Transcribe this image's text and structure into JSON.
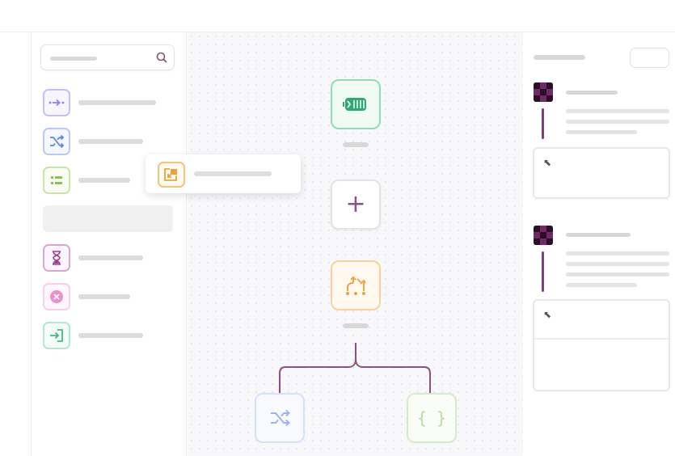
{
  "colors": {
    "purple": "#9b8cf0",
    "blue": "#8aa6f5",
    "green": "#9ad16a",
    "plum": "#b36aa8",
    "pink": "#f0a6d8",
    "teal": "#6fd1a9",
    "orange": "#f5c27a",
    "connector": "#8b4f86"
  },
  "sidebar": {
    "search_icon": "search-icon",
    "items": [
      {
        "icon": "merge-arrows-icon",
        "color": "#9b8cf0"
      },
      {
        "icon": "shuffle-icon",
        "color": "#8aa6f5"
      },
      {
        "icon": "grid-list-icon",
        "color": "#9ad16a"
      },
      {
        "icon": "hourglass-icon",
        "color": "#b36aa8"
      },
      {
        "icon": "close-circle-icon",
        "color": "#f0a6d8"
      },
      {
        "icon": "sign-in-icon",
        "color": "#6fd1a9"
      }
    ]
  },
  "drag_preview": {
    "icon": "import-icon"
  },
  "canvas": {
    "add_symbol": "+",
    "nodes": [
      {
        "icon": "battery-icon",
        "color": "#5fc79a"
      },
      {
        "icon": "add-icon",
        "color": "#d9d9d9"
      },
      {
        "icon": "branch-icon",
        "color": "#f5b04c"
      },
      {
        "icon": "shuffle-icon",
        "color": "#b9c9f7"
      },
      {
        "icon": "braces-icon",
        "color": "#c8e6b0"
      }
    ],
    "braces_symbol": "{ }"
  },
  "right_panel": {
    "reply_symbol": "⬉"
  }
}
